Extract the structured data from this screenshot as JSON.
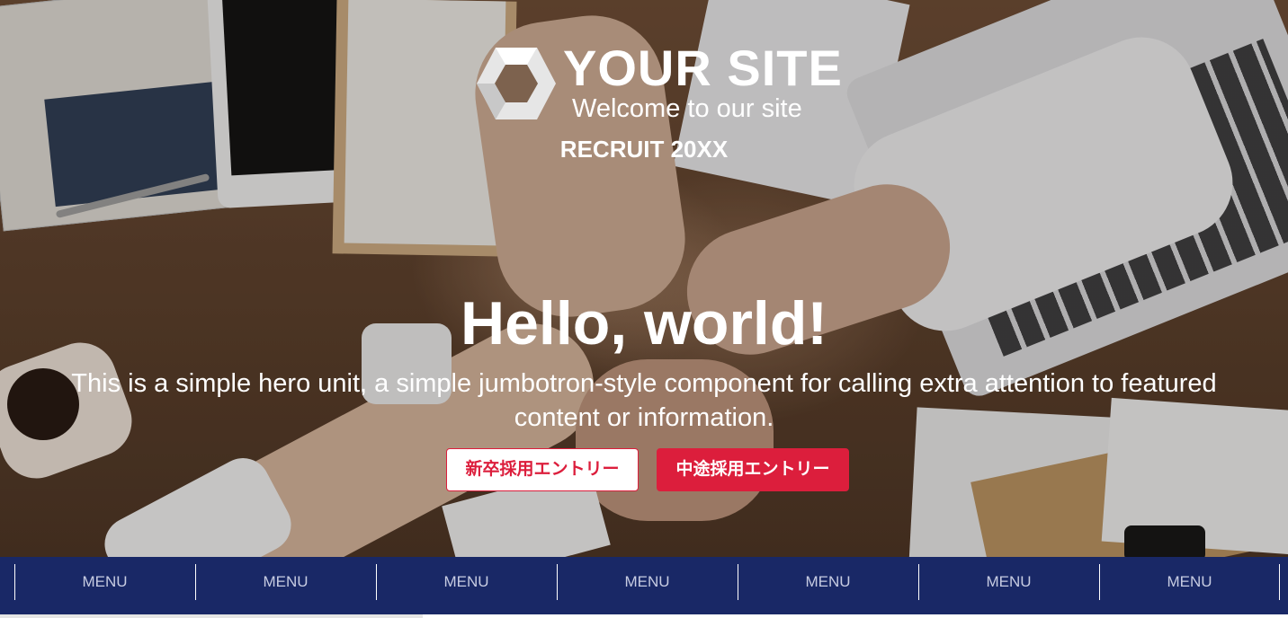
{
  "header": {
    "site_name": "YOUR SITE",
    "tagline": "Welcome to our site",
    "recruit_label": "RECRUIT 20XX"
  },
  "hero": {
    "title": "Hello, world!",
    "lead": "This is a simple hero unit, a simple jumbotron-style component for calling extra attention to featured content or information.",
    "buttons": {
      "new_grad": "新卒採用エントリー",
      "mid_career": "中途採用エントリー"
    }
  },
  "menu": {
    "items": [
      "MENU",
      "MENU",
      "MENU",
      "MENU",
      "MENU",
      "MENU",
      "MENU"
    ]
  },
  "colors": {
    "accent": "#dc1e3c",
    "menu_bar": "#192866",
    "menu_text": "#c7cce2"
  },
  "icons": {
    "logo": "hexagon-logo-icon"
  }
}
